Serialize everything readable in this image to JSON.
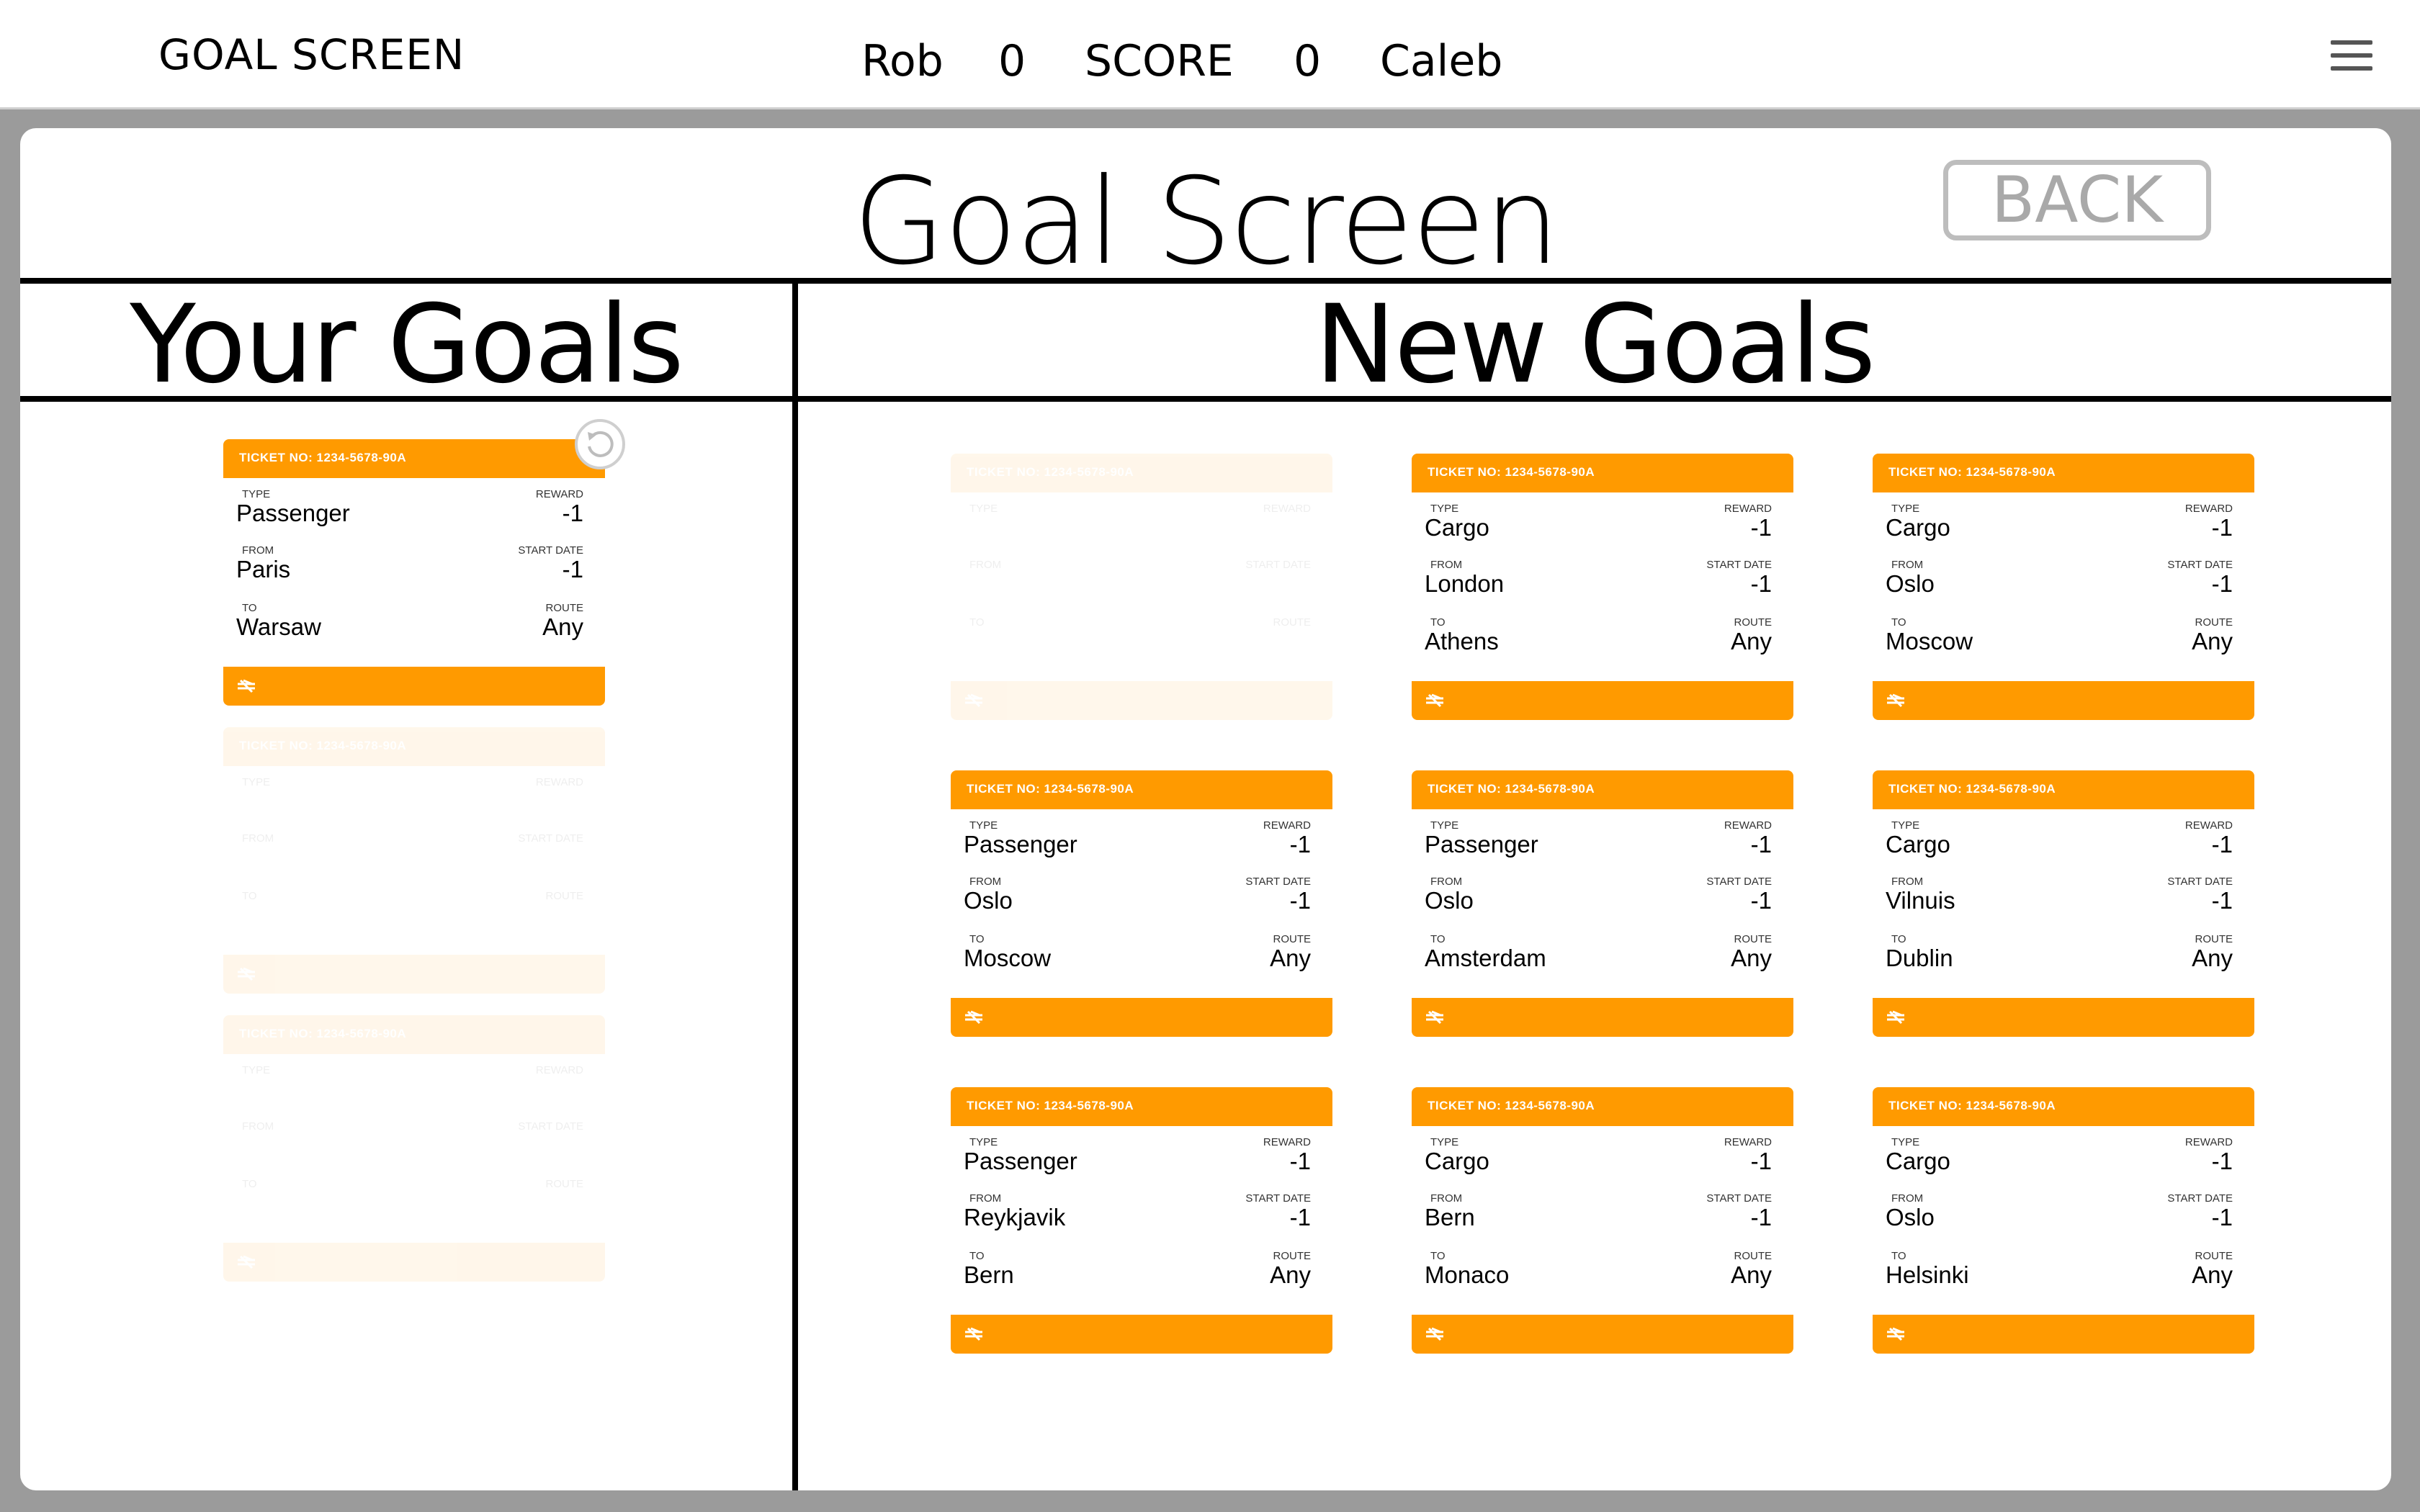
{
  "topbar": {
    "app_title": "GOAL SCREEN",
    "player1": "Rob",
    "score1": "0",
    "score_label": "SCORE",
    "score2": "0",
    "player2": "Caleb",
    "menu_icon": "hamburger-menu-icon"
  },
  "modal": {
    "title": "Goal Screen",
    "back_label": "BACK",
    "your_goals_title": "Your Goals",
    "new_goals_title": "New Goals",
    "refresh_icon": "refresh-icon"
  },
  "labels": {
    "type": "TYPE",
    "reward": "REWARD",
    "from": "FROM",
    "start_date": "START DATE",
    "to": "TO",
    "route": "ROUTE"
  },
  "colors": {
    "accent": "#ff9a00",
    "background": "#9b9b9b"
  },
  "your_goals": [
    {
      "ticket_no": "TICKET NO: 1234-5678-90A",
      "type": "Passenger",
      "reward": "-1",
      "from": "Paris",
      "start_date": "-1",
      "to": "Warsaw",
      "route": "Any",
      "faded": false
    },
    {
      "ticket_no": "TICKET NO: 1234-5678-90A",
      "type": "",
      "reward": "",
      "from": "",
      "start_date": "",
      "to": "",
      "route": "",
      "faded": true
    },
    {
      "ticket_no": "TICKET NO: 1234-5678-90A",
      "type": "",
      "reward": "",
      "from": "",
      "start_date": "",
      "to": "",
      "route": "",
      "faded": true
    }
  ],
  "new_goals": [
    {
      "ticket_no": "TICKET NO: 1234-5678-90A",
      "type": "",
      "reward": "",
      "from": "",
      "start_date": "",
      "to": "",
      "route": "",
      "faded": true
    },
    {
      "ticket_no": "TICKET NO: 1234-5678-90A",
      "type": "Cargo",
      "reward": "-1",
      "from": "London",
      "start_date": "-1",
      "to": "Athens",
      "route": "Any",
      "faded": false
    },
    {
      "ticket_no": "TICKET NO: 1234-5678-90A",
      "type": "Cargo",
      "reward": "-1",
      "from": "Oslo",
      "start_date": "-1",
      "to": "Moscow",
      "route": "Any",
      "faded": false
    },
    {
      "ticket_no": "TICKET NO: 1234-5678-90A",
      "type": "Passenger",
      "reward": "-1",
      "from": "Oslo",
      "start_date": "-1",
      "to": "Moscow",
      "route": "Any",
      "faded": false
    },
    {
      "ticket_no": "TICKET NO: 1234-5678-90A",
      "type": "Passenger",
      "reward": "-1",
      "from": "Oslo",
      "start_date": "-1",
      "to": "Amsterdam",
      "route": "Any",
      "faded": false
    },
    {
      "ticket_no": "TICKET NO: 1234-5678-90A",
      "type": "Cargo",
      "reward": "-1",
      "from": "Vilnuis",
      "start_date": "-1",
      "to": "Dublin",
      "route": "Any",
      "faded": false
    },
    {
      "ticket_no": "TICKET NO: 1234-5678-90A",
      "type": "Passenger",
      "reward": "-1",
      "from": "Reykjavik",
      "start_date": "-1",
      "to": "Bern",
      "route": "Any",
      "faded": false
    },
    {
      "ticket_no": "TICKET NO: 1234-5678-90A",
      "type": "Cargo",
      "reward": "-1",
      "from": "Bern",
      "start_date": "-1",
      "to": "Monaco",
      "route": "Any",
      "faded": false
    },
    {
      "ticket_no": "TICKET NO: 1234-5678-90A",
      "type": "Cargo",
      "reward": "-1",
      "from": "Oslo",
      "start_date": "-1",
      "to": "Helsinki",
      "route": "Any",
      "faded": false
    }
  ]
}
